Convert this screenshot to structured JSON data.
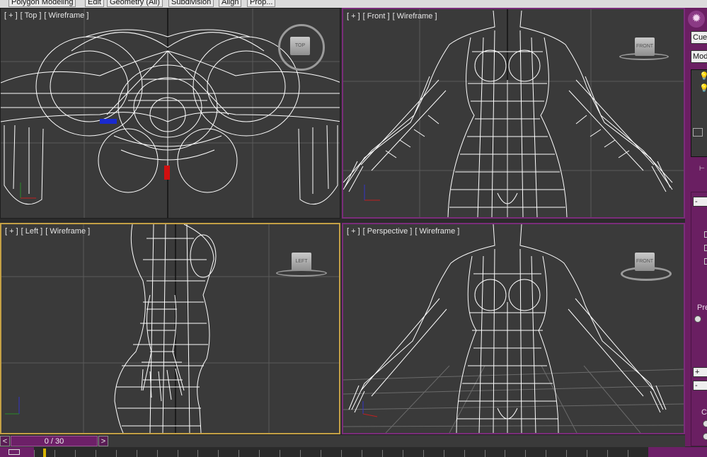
{
  "ribbon": {
    "tabs": [
      "Polygon Modeling",
      "Edit",
      "Geometry (All)",
      "Subdivision",
      "Align",
      "Prop..."
    ]
  },
  "viewports": {
    "top": {
      "label": [
        "[ + ]",
        "[ Top ]",
        "[ Wireframe ]"
      ],
      "cube": "TOP"
    },
    "front": {
      "label": [
        "[ + ]",
        "[ Front ]",
        "[ Wireframe ]"
      ],
      "cube": "FRONT"
    },
    "left": {
      "label": [
        "[ + ]",
        "[ Left ]",
        "[ Wireframe ]"
      ],
      "cube": "LEFT"
    },
    "persp": {
      "label": [
        "[ + ]",
        "[ Perspective ]",
        "[ Wireframe ]"
      ],
      "cube": "FRONT"
    }
  },
  "command_panel": {
    "settings_icon": "gear-icon",
    "object_name": "Cuer",
    "modifier_list": "Mod",
    "plus": "+",
    "minus": "-",
    "minus2": "-",
    "plus2": "+",
    "minus3": "-",
    "preset_label": "Pre",
    "co_label": "Co"
  },
  "time_slider": {
    "prev": "<",
    "next": ">",
    "frame_readout": "0 / 30",
    "current_frame": 0,
    "total_frames": 30
  },
  "colors": {
    "accent": "#6d2068",
    "active_border": "#c4a045",
    "viewport_bg": "#3a3a3a",
    "wireframe": "#ffffff"
  }
}
